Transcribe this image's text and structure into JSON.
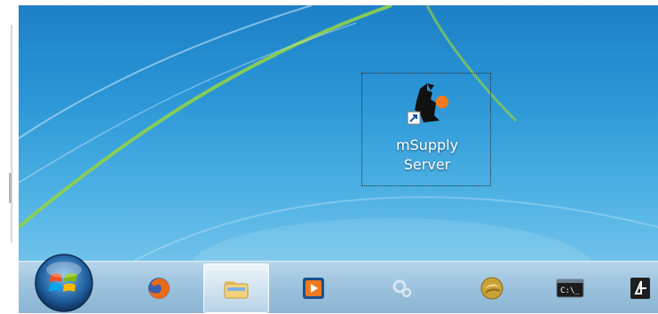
{
  "desktop": {
    "icon": {
      "label_line1": "mSupply",
      "label_line2": "Server",
      "icon": "msupply-server-shortcut-icon"
    }
  },
  "taskbar": {
    "start": {
      "icon": "windows-start-orb-icon"
    },
    "items": [
      {
        "name": "firefox",
        "icon": "firefox-icon"
      },
      {
        "name": "windows-explorer",
        "icon": "folder-icon",
        "active": true
      },
      {
        "name": "media-player",
        "icon": "play-icon"
      },
      {
        "name": "settings-tool",
        "icon": "gears-icon"
      },
      {
        "name": "app-gold",
        "icon": "gold-orb-icon"
      },
      {
        "name": "command-prompt",
        "icon": "cmd-icon",
        "text": "C:\\_"
      },
      {
        "name": "partial-app",
        "icon": "partial-app-icon"
      }
    ]
  },
  "colors": {
    "desktop": "#2a95d6",
    "taskbar": "#9dc3de"
  }
}
